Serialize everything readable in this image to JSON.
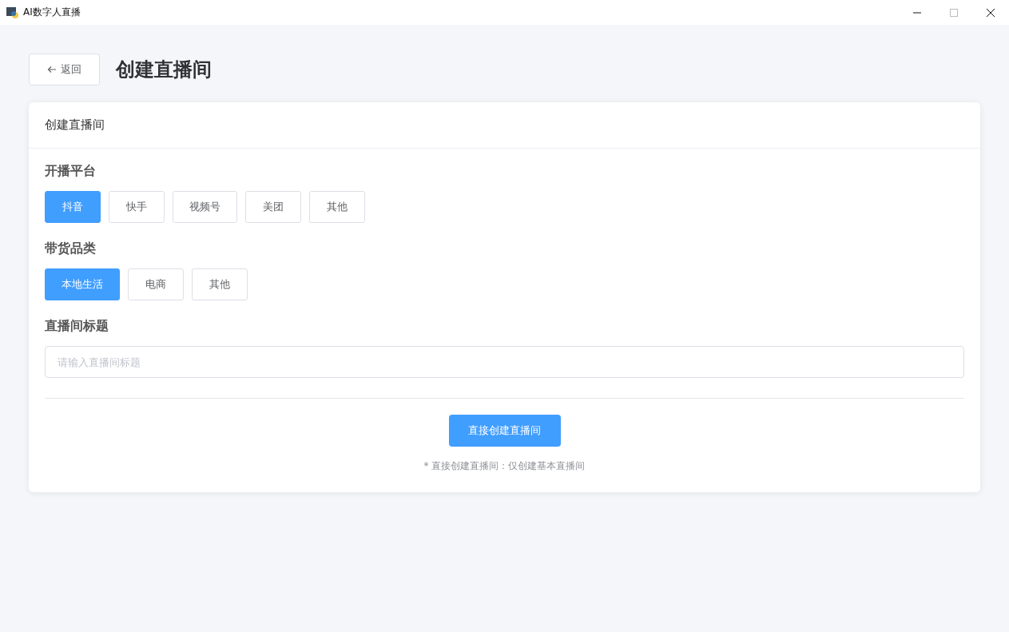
{
  "window": {
    "title": "AI数字人直播"
  },
  "header": {
    "back_button": "返回",
    "title": "创建直播间"
  },
  "card": {
    "title": "创建直播间",
    "groups": [
      {
        "label": "开播平台",
        "options": [
          {
            "label": "抖音",
            "selected": true
          },
          {
            "label": "快手",
            "selected": false
          },
          {
            "label": "视频号",
            "selected": false
          },
          {
            "label": "美团",
            "selected": false
          },
          {
            "label": "其他",
            "selected": false
          }
        ]
      },
      {
        "label": "带货品类",
        "options": [
          {
            "label": "本地生活",
            "selected": true
          },
          {
            "label": "电商",
            "selected": false
          },
          {
            "label": "其他",
            "selected": false
          }
        ]
      }
    ],
    "title_field": {
      "label": "直播间标题",
      "placeholder": "请输入直播间标题"
    },
    "submit_button": "直接创建直播间",
    "note": "* 直接创建直播间：仅创建基本直播间"
  }
}
